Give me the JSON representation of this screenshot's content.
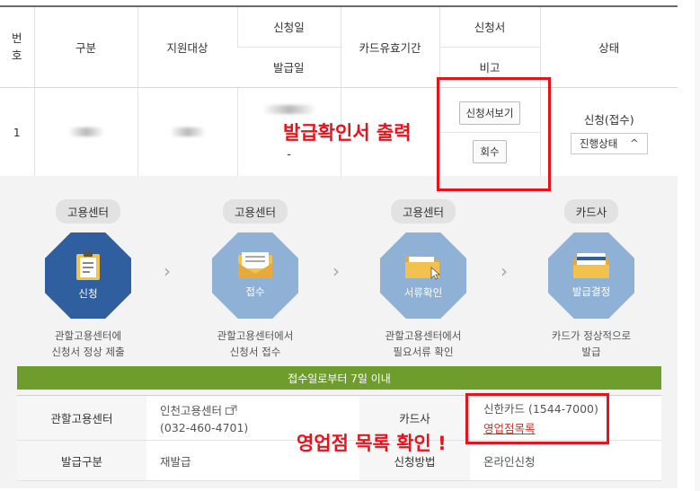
{
  "table": {
    "headers": {
      "no": "번호",
      "category": "구분",
      "target": "지원대상",
      "apply_date": "신청일",
      "issue_date": "발급일",
      "card_valid": "카드유효기간",
      "form": "신청서",
      "note": "비고",
      "status": "상태"
    },
    "row": {
      "no": "1",
      "issue_date": "-",
      "view_form_button": "신청서보기",
      "withdraw_button": "회수",
      "status": "신청(접수)",
      "progress_select": "진행상태",
      "progress_chevron": "^"
    }
  },
  "steps": [
    {
      "tag": "고용센터",
      "label": "신청",
      "desc1": "관할고용센터에",
      "desc2": "신청서 정상 제출",
      "icon": "clipboard-icon"
    },
    {
      "tag": "고용센터",
      "label": "접수",
      "desc1": "관할고용센터에서",
      "desc2": "신청서 접수",
      "icon": "envelope-icon"
    },
    {
      "tag": "고용센터",
      "label": "서류확인",
      "desc1": "관할고용센터에서",
      "desc2": "필요서류 확인",
      "icon": "folder-icon"
    },
    {
      "tag": "카드사",
      "label": "발급결정",
      "desc1": "카드가 정상적으로",
      "desc2": "발급",
      "icon": "card-icon"
    }
  ],
  "arrow": "›",
  "deadline_bar": "접수일로부터 7일 이내",
  "info": {
    "center_label": "관할고용센터",
    "center_name": "인천고용센터",
    "center_phone": "(032-460-4701)",
    "card_label": "카드사",
    "card_name": "신한카드 (1544-7000)",
    "branch_link": "영업점목록",
    "issue_type_label": "발급구분",
    "issue_type": "재발급",
    "method_label": "신청방법",
    "method": "온라인신청"
  },
  "annotations": {
    "print_confirm": "발급확인서 출력",
    "branch_check": "영업점 목록 확인 !"
  },
  "colors": {
    "accent_red": "#e8121c",
    "hex_dark": "#2f5f9e",
    "hex_light": "#8fb1d6",
    "green_bar": "#6e9d2d"
  }
}
